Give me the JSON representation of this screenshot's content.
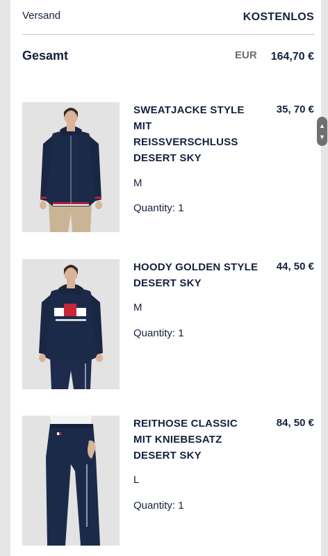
{
  "summary": {
    "shipping_label": "Versand",
    "shipping_value": "KOSTENLOS",
    "total_label": "Gesamt",
    "total_currency": "EUR",
    "total_value": "164,70 €"
  },
  "products": [
    {
      "name": "SWEATJACKE STYLE MIT REISSVERSCHLUSS DESERT SKY",
      "price": "35, 70 €",
      "size": "M",
      "quantity": "Quantity: 1",
      "image_icon": "zip-sweat-jacket-image"
    },
    {
      "name": "HOODY GOLDEN STYLE DESERT SKY",
      "price": "44, 50 €",
      "size": "M",
      "quantity": "Quantity: 1",
      "image_icon": "hoody-image"
    },
    {
      "name": "REITHOSE CLASSIC MIT KNIEBESATZ DESERT SKY",
      "price": "84, 50 €",
      "size": "L",
      "quantity": "Quantity: 1",
      "image_icon": "riding-breeches-image"
    }
  ],
  "colors": {
    "text": "#14213d",
    "muted": "#6b6b6b",
    "navy_garment": "#1c2a4a",
    "photo_bg": "#e3e3e3",
    "frame": "#e6e6e6"
  },
  "scrollbar": {
    "up_icon": "chevron-up-icon",
    "down_icon": "chevron-down-icon"
  }
}
